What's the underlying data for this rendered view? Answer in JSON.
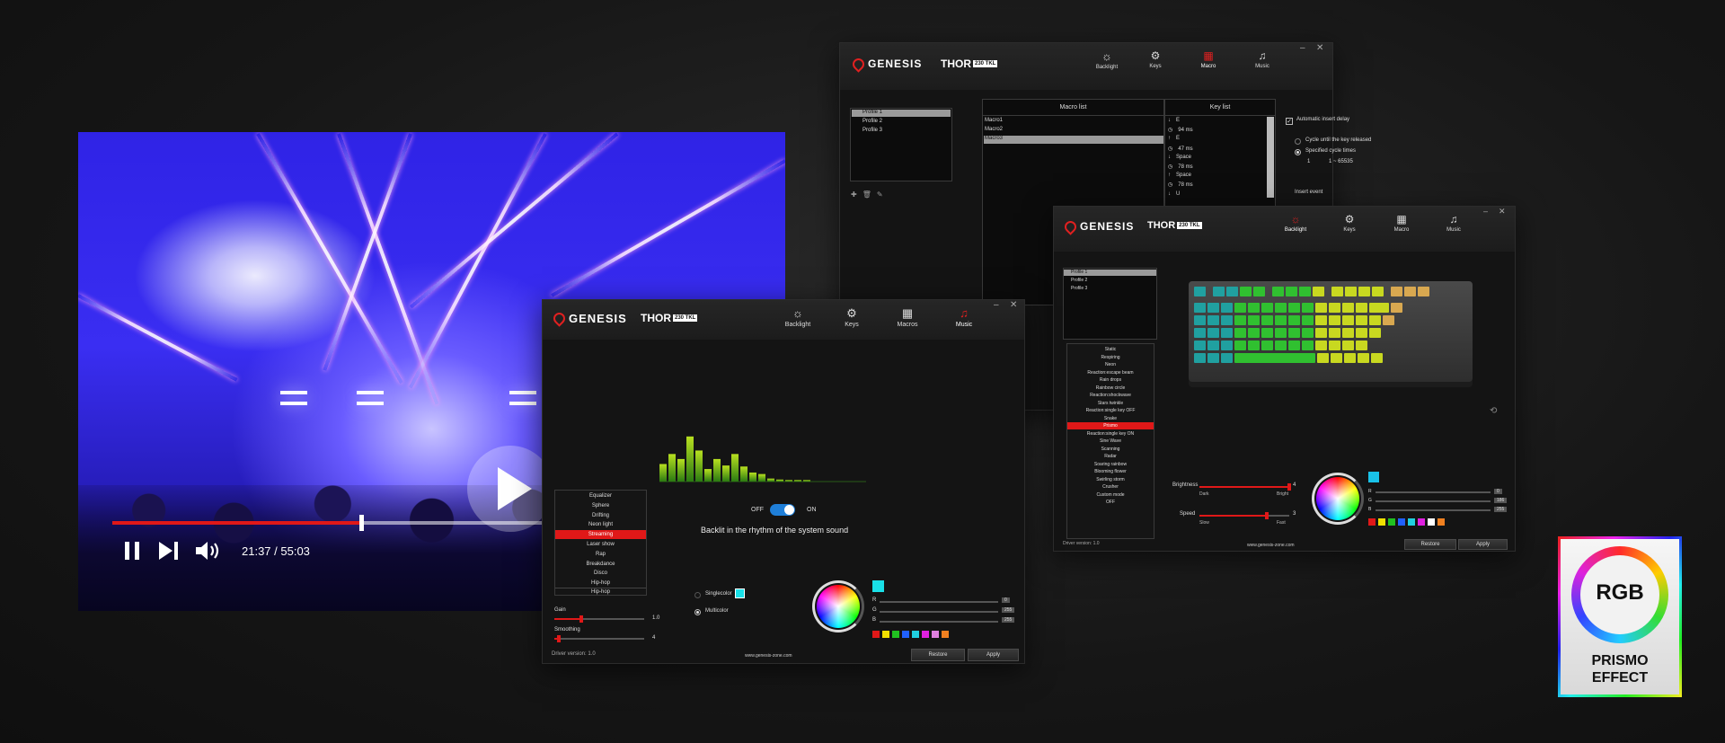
{
  "video": {
    "time": "21:37 / 55:03",
    "progress": 0.37
  },
  "common": {
    "brand": "GENESIS",
    "model": "THOR",
    "model_badge": "230 TKL",
    "nav": {
      "backlight": "Backlight",
      "keys": "Keys",
      "macro": "Macro",
      "macros": "Macros",
      "music": "Music"
    },
    "site": "www.genesis-zone.com",
    "driver": "Driver version:  1.0",
    "restore": "Restore",
    "apply": "Apply"
  },
  "macro_window": {
    "profiles": [
      "Profile 1",
      "Profile 2",
      "Profile 3"
    ],
    "macro_list_header": "Macro list",
    "key_list_header": "Key list",
    "macros": [
      "Macro1",
      "Macro2",
      "Macro3"
    ],
    "keys": [
      {
        "icon": "down-arrow",
        "text": "E"
      },
      {
        "icon": "clock",
        "text": "94 ms"
      },
      {
        "icon": "up-arrow",
        "text": "E"
      },
      {
        "icon": "clock",
        "text": "47 ms"
      },
      {
        "icon": "down-arrow",
        "text": "Space"
      },
      {
        "icon": "clock",
        "text": "78 ms"
      },
      {
        "icon": "up-arrow",
        "text": "Space"
      },
      {
        "icon": "clock",
        "text": "78 ms"
      },
      {
        "icon": "down-arrow",
        "text": "U"
      }
    ],
    "auto_delay": "Automatic insert delay",
    "cycle_release": "Cycle until the key released",
    "specified_cycles": "Specified cycle times",
    "cycle_value": "1",
    "cycle_range": "1 ~ 65535",
    "insert_event": "Insert event"
  },
  "backlight_window": {
    "profiles": [
      "Profile 1",
      "Profile 2",
      "Profile 3"
    ],
    "effects": [
      "Static",
      "Respiring",
      "Neon",
      "Reaction:escape beam",
      "Rain drops",
      "Rainbow circle",
      "Reaction:shockwave",
      "Stars twinkle",
      "Reaction:single key OFF",
      "Snake",
      "Prismo",
      "Reaction:single key ON",
      "Sine Wave",
      "Scanning",
      "Radar",
      "Soaring rainbow",
      "Blooming flower",
      "Swirling storm",
      "Crusher",
      "Custom mode",
      "OFF"
    ],
    "selected_effect": "Prismo",
    "brightness_label": "Brightness",
    "brightness_value": "4",
    "brightness_level": 1.0,
    "dark": "Dark",
    "bright": "Bright",
    "speed_label": "Speed",
    "speed_value": "3",
    "speed_level": 0.75,
    "slow": "Slow",
    "fast": "Fast",
    "r_label": "R",
    "g_label": "G",
    "b_label": "B",
    "r_value": "0",
    "g_value": "186",
    "b_value": "255",
    "selected_color": "#19c2e8",
    "palette": [
      "#e01818",
      "#f0e000",
      "#20c020",
      "#2060ff",
      "#20d0e0",
      "#e020e0",
      "#ffffff",
      "#f08020"
    ]
  },
  "music_window": {
    "modes": [
      "Equalizer",
      "Sphere",
      "Drifting",
      "Neon light",
      "Streaming",
      "Laser show",
      "Rap",
      "Breakdance",
      "Disco",
      "Hip-hop"
    ],
    "selected_mode": "Streaming",
    "dropdown_value": "Hip-hop",
    "gain_label": "Gain",
    "gain_value": "1.0",
    "gain_level": 0.3,
    "smoothing_label": "Smoothing",
    "smoothing_value": "4",
    "smoothing_level": 0.05,
    "off": "OFF",
    "on": "ON",
    "toggle_on": true,
    "caption": "Backlit in the rhythm of the system sound",
    "singlecolor": "Singlecolor",
    "multicolor": "Multicolor",
    "r_label": "R",
    "g_label": "G",
    "b_label": "B",
    "r_value": "0",
    "g_value": "255",
    "b_value": "255",
    "selected_color": "#19e0e8",
    "palette": [
      "#e01818",
      "#f0e000",
      "#20c020",
      "#2060ff",
      "#20d0e0",
      "#e020e0",
      "#e080e0",
      "#f08020"
    ],
    "equalizer": [
      0.35,
      0.55,
      0.45,
      0.9,
      0.62,
      0.25,
      0.45,
      0.32,
      0.55,
      0.3,
      0.18,
      0.15,
      0.06,
      0.04,
      0.03,
      0.03,
      0.03
    ]
  },
  "rgb_badge": {
    "title": "RGB",
    "line1": "PRISMO",
    "line2": "EFFECT"
  }
}
